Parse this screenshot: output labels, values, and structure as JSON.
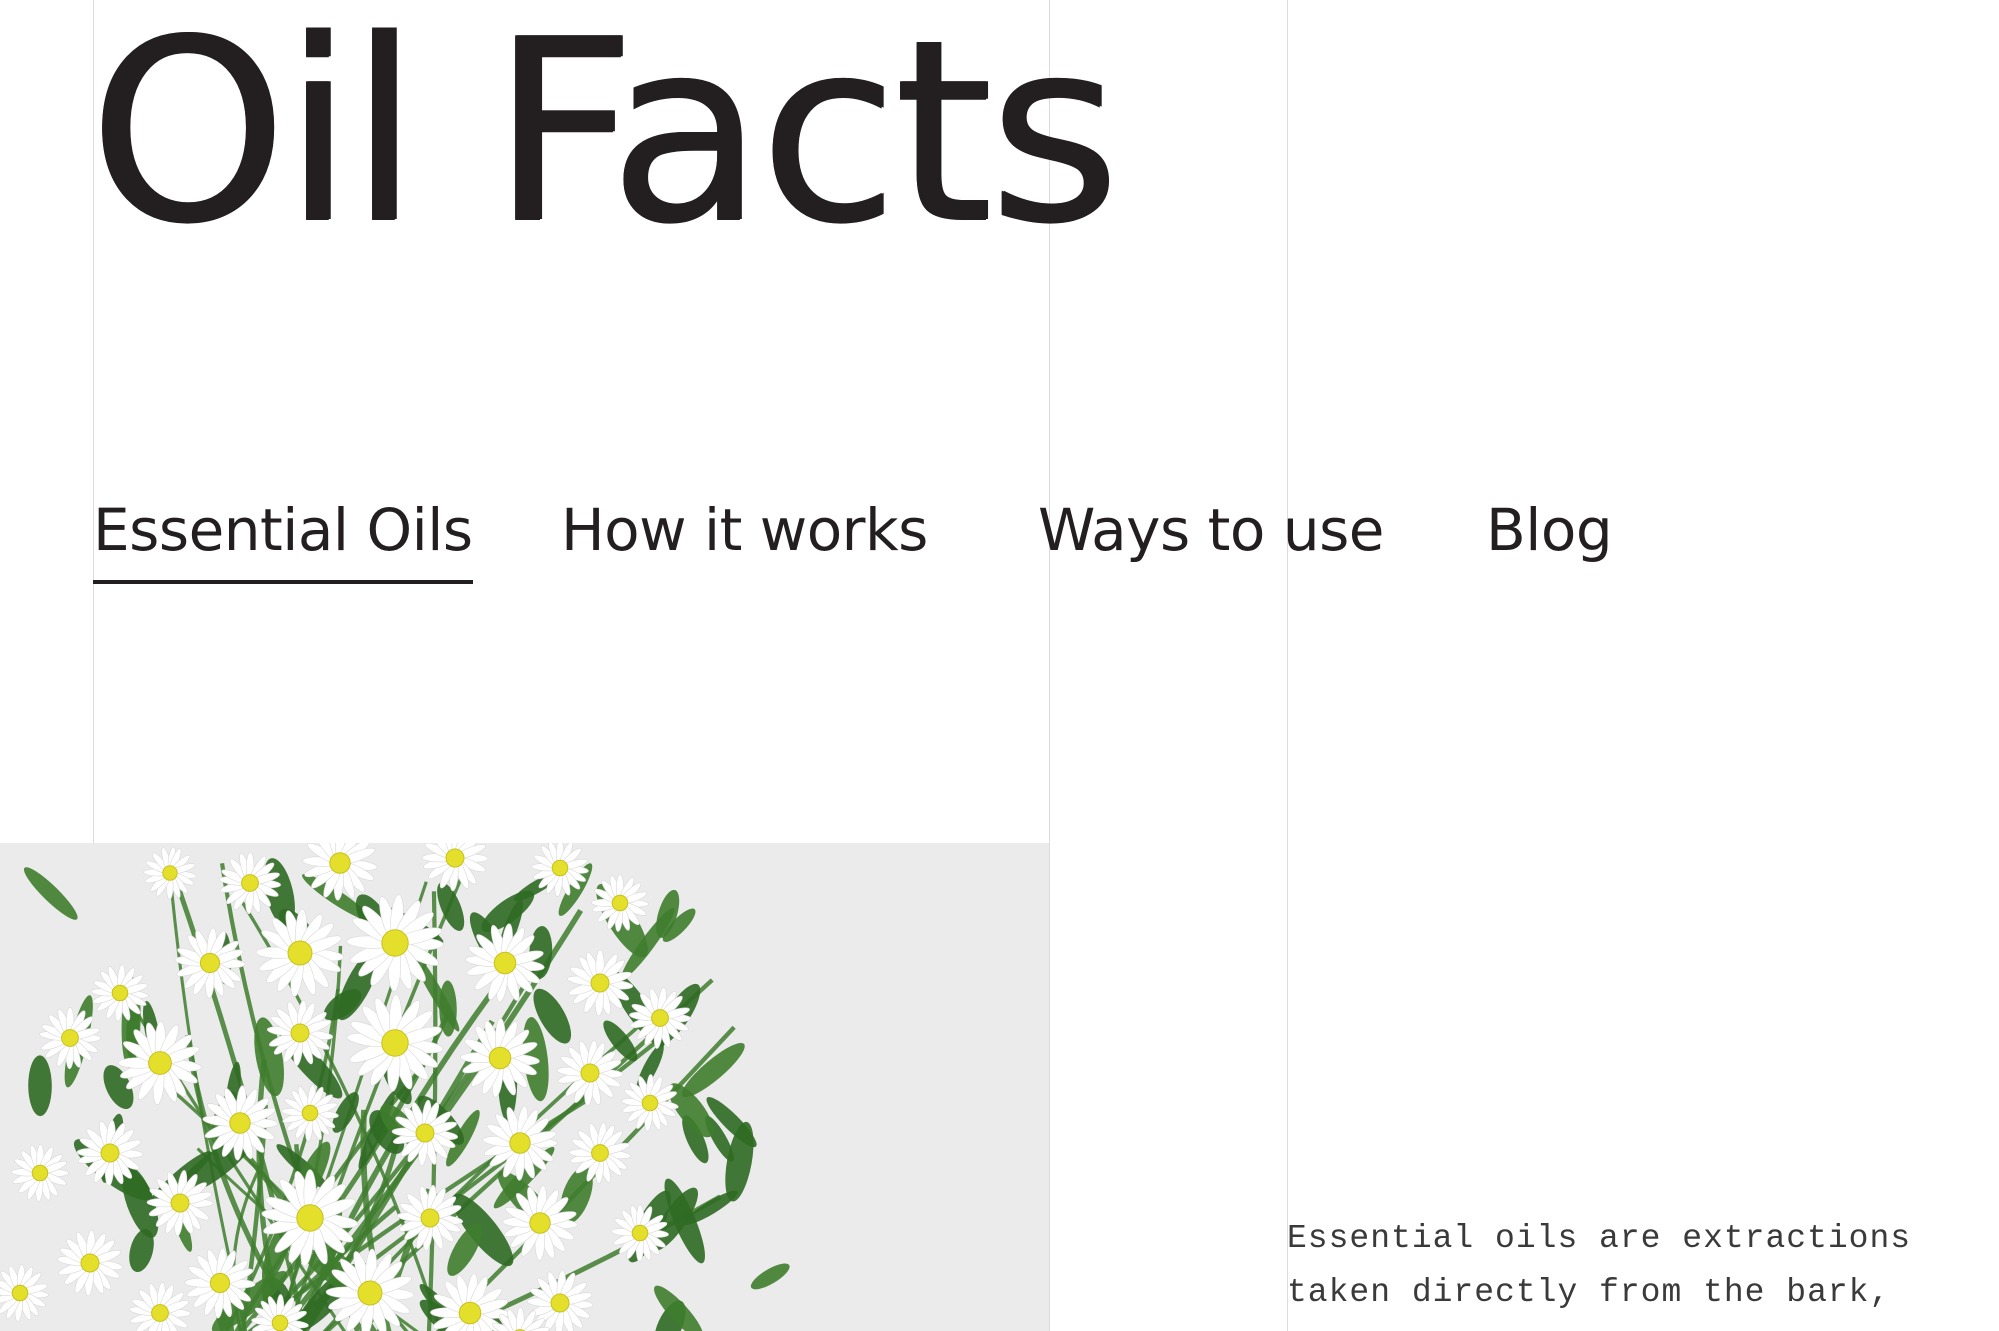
{
  "site": {
    "title": "Oil Facts"
  },
  "nav": {
    "items": [
      {
        "label": "Essential Oils",
        "active": true
      },
      {
        "label": "How it works",
        "active": false
      },
      {
        "label": "Ways to use",
        "active": false
      },
      {
        "label": "Blog",
        "active": false
      }
    ]
  },
  "hero": {
    "image_subject": "bouquet of white daisies with yellow centers"
  },
  "intro": {
    "text": "Essential oils are extractions taken directly from the bark,"
  },
  "colors": {
    "text": "#231f20",
    "image_background": "#ebebeb",
    "gridline": "#dcdcdc",
    "daisy_petal": "#ffffff",
    "daisy_center": "#e3df2a",
    "foliage": "#3f7d2e"
  }
}
